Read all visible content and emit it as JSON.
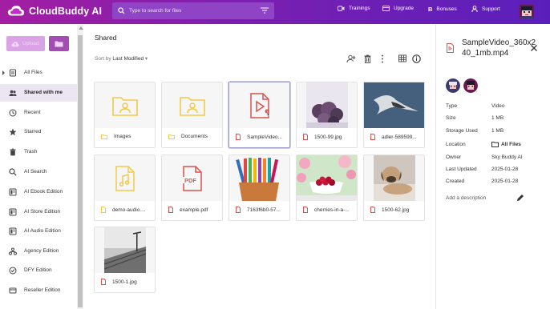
{
  "app": {
    "name": "CloudBuddy AI"
  },
  "search": {
    "placeholder": "Type to search for files"
  },
  "nav": [
    {
      "label": "Trainings",
      "icon": "video-icon"
    },
    {
      "label": "Upgrade",
      "icon": "card-icon"
    },
    {
      "label": "Bonuses",
      "icon": "b-icon"
    },
    {
      "label": "Support",
      "icon": "person-icon"
    }
  ],
  "sidebar": {
    "upload_label": "Upload",
    "items": [
      {
        "label": "All Files",
        "icon": "files-icon"
      },
      {
        "label": "Shared with me",
        "icon": "shared-icon"
      },
      {
        "label": "Recent",
        "icon": "clock-icon"
      },
      {
        "label": "Starred",
        "icon": "star-icon"
      },
      {
        "label": "Trash",
        "icon": "trash-icon"
      },
      {
        "label": "AI Search",
        "icon": "search-icon"
      },
      {
        "label": "AI Ebook Edition",
        "icon": "ebook-icon"
      },
      {
        "label": "AI Store Edition",
        "icon": "store-icon"
      },
      {
        "label": "AI Audio Edition",
        "icon": "audio-icon"
      },
      {
        "label": "Agency Edition",
        "icon": "agency-icon"
      },
      {
        "label": "DFY Edition",
        "icon": "dfy-icon"
      },
      {
        "label": "Reseller Edition",
        "icon": "reseller-icon"
      }
    ],
    "active_index": 1
  },
  "main": {
    "title": "Shared",
    "sort_prefix": "Sort by",
    "sort_value": "Last Modified",
    "files": [
      {
        "name": "Images",
        "kind": "folder"
      },
      {
        "name": "Documents",
        "kind": "folder"
      },
      {
        "name": "SampleVideo...",
        "kind": "video",
        "selected": true
      },
      {
        "name": "1500-99.jpg",
        "kind": "photo-grapes"
      },
      {
        "name": "adler-589599...",
        "kind": "photo-eagle"
      },
      {
        "name": "demo-audio....",
        "kind": "audio"
      },
      {
        "name": "example.pdf",
        "kind": "pdf"
      },
      {
        "name": "7163f6b0-57...",
        "kind": "photo-pencils"
      },
      {
        "name": "cherries-in-a-...",
        "kind": "photo-cherries"
      },
      {
        "name": "1500-62.jpg",
        "kind": "photo-dog"
      },
      {
        "name": "1500-1.jpg",
        "kind": "photo-pier"
      }
    ]
  },
  "panel": {
    "title": "SampleVideo_360x240_1mb.mp4",
    "rows": [
      {
        "label": "Type",
        "value": "Video"
      },
      {
        "label": "Size",
        "value": "1 MB"
      },
      {
        "label": "Storage Used",
        "value": "1 MB"
      },
      {
        "label": "Location",
        "value": "All Files"
      },
      {
        "label": "Owner",
        "value": "Sky Buddy AI"
      },
      {
        "label": "Last Updated",
        "value": "2025-01-28"
      },
      {
        "label": "Created",
        "value": "2025-01-28"
      }
    ],
    "add_description": "Add a description"
  },
  "colors": {
    "brand_start": "#a31ea3",
    "brand_end": "#5a1fbb",
    "folder": "#f2c94c",
    "pdf": "#d9534f"
  }
}
